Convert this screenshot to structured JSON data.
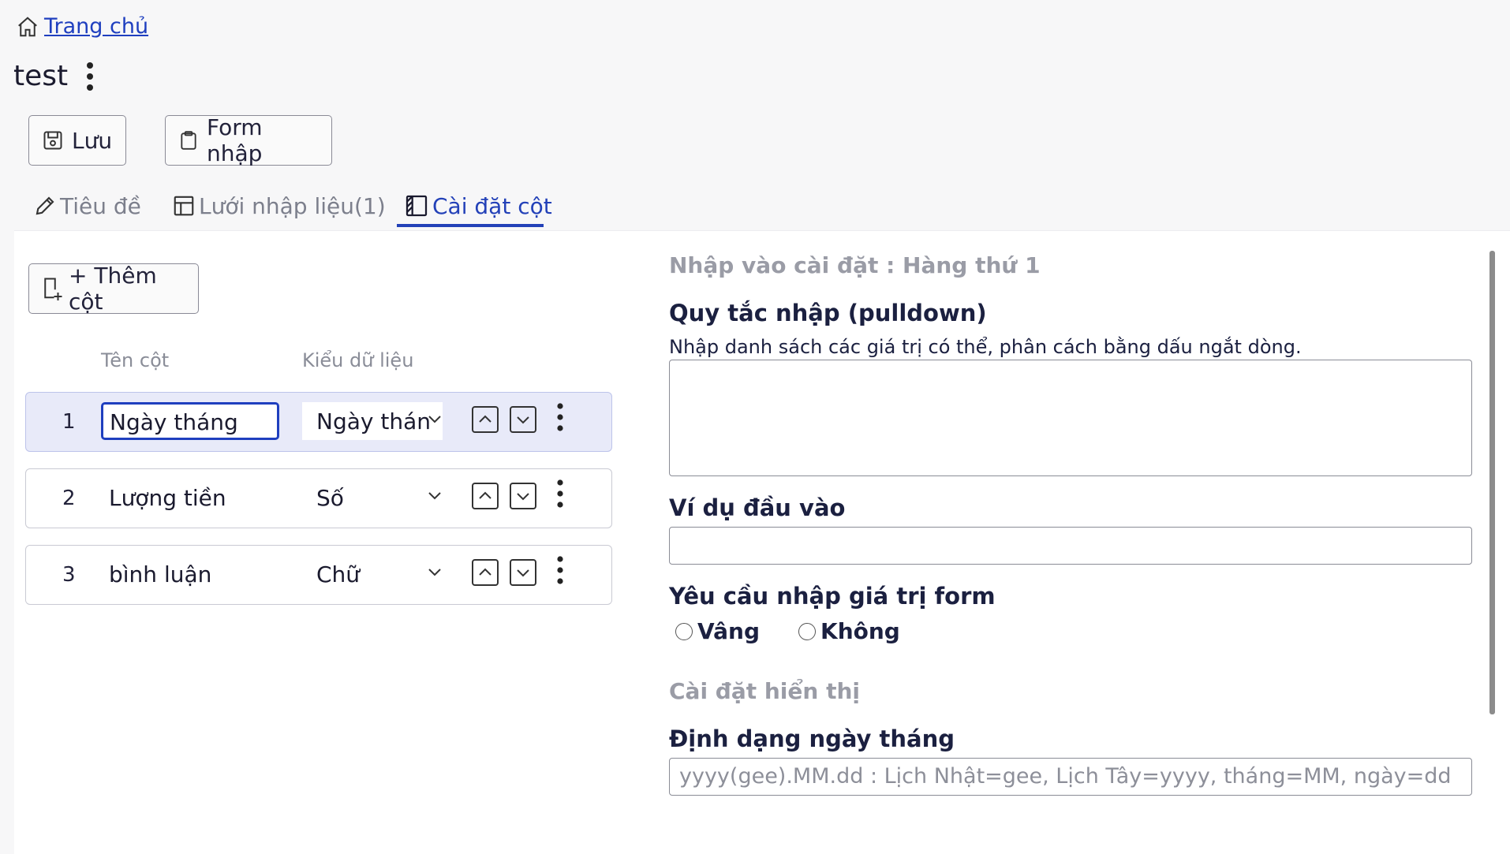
{
  "breadcrumb": {
    "home_label": "Trang chủ"
  },
  "page": {
    "title": "test"
  },
  "toolbar": {
    "save_label": "Lưu",
    "form_label": "Form nhập"
  },
  "tabs": [
    {
      "label": "Tiêu đề",
      "icon": "pencil-icon"
    },
    {
      "label": "Lưới nhập liệu(1)",
      "icon": "grid-icon"
    },
    {
      "label": "Cài đặt cột",
      "icon": "column-icon",
      "active": true
    }
  ],
  "columns": {
    "add_label": "+ Thêm cột",
    "header_name": "Tên cột",
    "header_type": "Kiểu dữ liệu",
    "rows": [
      {
        "index": "1",
        "name": "Ngày tháng",
        "type": "Ngày thán",
        "selected": true
      },
      {
        "index": "2",
        "name": "Lượng tiền",
        "type": "Số"
      },
      {
        "index": "3",
        "name": "bình luận",
        "type": "Chữ"
      }
    ]
  },
  "settings": {
    "heading": "Nhập vào cài đặt : Hàng thứ 1",
    "rule_label": "Quy tắc nhập (pulldown)",
    "rule_desc": "Nhập danh sách các giá trị có thể, phân cách bằng dấu ngắt dòng.",
    "rule_value": "",
    "example_label": "Ví dụ đầu vào",
    "example_value": "",
    "required_label": "Yêu cầu nhập giá trị form",
    "required_yes": "Vâng",
    "required_no": "Không",
    "display_heading": "Cài đặt hiển thị",
    "date_format_label": "Định dạng ngày tháng",
    "date_format_placeholder": "yyyy(gee).MM.dd : Lịch Nhật=gee, Lịch Tây=yyyy, tháng=MM, ngày=dd"
  },
  "colors": {
    "accent": "#2341b8",
    "selected_row": "#e8eaf9"
  }
}
